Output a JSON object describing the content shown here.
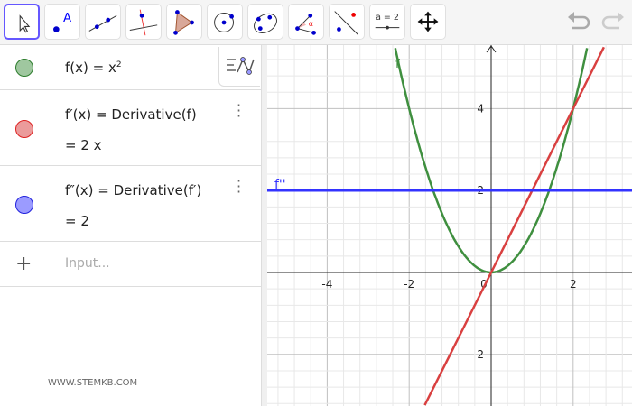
{
  "toolbar": {
    "tools": [
      {
        "name": "move",
        "selected": true
      },
      {
        "name": "point"
      },
      {
        "name": "line"
      },
      {
        "name": "perpendicular-line"
      },
      {
        "name": "polygon"
      },
      {
        "name": "circle-center-point"
      },
      {
        "name": "conic-five-points"
      },
      {
        "name": "angle"
      },
      {
        "name": "reflect-about-line"
      },
      {
        "name": "slider",
        "label": "a = 2"
      },
      {
        "name": "move-graphics-view"
      }
    ]
  },
  "algebra": {
    "items": [
      {
        "color": "#5e9e5e",
        "definition": "f(x) = x",
        "sup": "2"
      },
      {
        "color": "#e06666",
        "definition": "f′(x) = Derivative(f)",
        "value": "=  2 x"
      },
      {
        "color": "#6666ff",
        "definition": "f″(x) = Derivative(f′)",
        "value": "=  2"
      }
    ],
    "input_placeholder": "Input..."
  },
  "watermark": "WWW.STEMKB.COM",
  "graph": {
    "x_ticks": [
      "-4",
      "-2",
      "0",
      "2"
    ],
    "y_ticks": [
      "4",
      "2",
      "-2"
    ],
    "labels": {
      "f": "f",
      "f2": "f''"
    },
    "colors": {
      "f": "#3f8f3f",
      "f1": "#d94040",
      "f2": "#3333ff"
    }
  }
}
